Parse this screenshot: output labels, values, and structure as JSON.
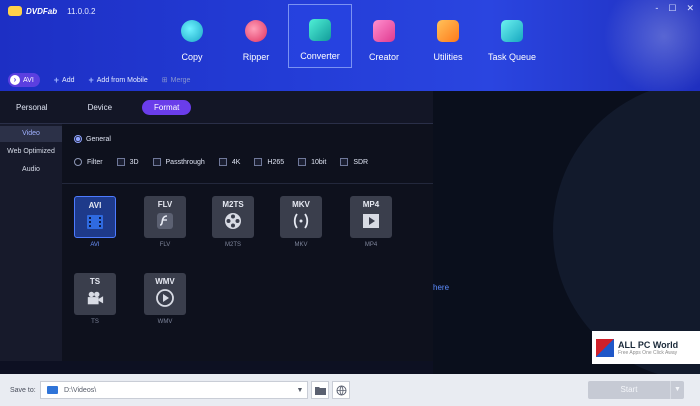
{
  "app": {
    "logo": "DVDFab",
    "version": "11.0.0.2"
  },
  "window_controls": [
    "-",
    "☐",
    "✕"
  ],
  "nav": [
    {
      "label": "Copy",
      "icon": "copy-icon",
      "color": "#29c7d9"
    },
    {
      "label": "Ripper",
      "icon": "ripper-icon",
      "color": "#ff4f7a"
    },
    {
      "label": "Converter",
      "icon": "converter-icon",
      "color": "#28c7b8"
    },
    {
      "label": "Creator",
      "icon": "creator-icon",
      "color": "#ff5aa8"
    },
    {
      "label": "Utilities",
      "icon": "utilities-icon",
      "color": "#ff9b32"
    },
    {
      "label": "Task Queue",
      "icon": "task-queue-icon",
      "color": "#2ad0d6"
    }
  ],
  "toolbar": {
    "format_pill": "AVI",
    "add": "Add",
    "add_mobile": "Add from Mobile",
    "merge": "Merge"
  },
  "panel": {
    "tabs": [
      "Personal",
      "Device",
      "Format"
    ],
    "categories": [
      "Video",
      "Web Optimized",
      "Audio"
    ],
    "general_label": "General",
    "filter_label": "Filter",
    "filters": [
      "3D",
      "Passthrough",
      "4K",
      "H265",
      "10bit",
      "SDR"
    ]
  },
  "formats": [
    {
      "title": "AVI",
      "label": "AVI",
      "icon": "film-icon"
    },
    {
      "title": "FLV",
      "label": "FLV",
      "icon": "flash-icon"
    },
    {
      "title": "M2TS",
      "label": "M2TS",
      "icon": "reel-icon"
    },
    {
      "title": "MKV",
      "label": "MKV",
      "icon": "mkv-icon"
    },
    {
      "title": "MP4",
      "label": "MP4",
      "icon": "play-icon"
    },
    {
      "title": "TS",
      "label": "TS",
      "icon": "camera-icon"
    },
    {
      "title": "WMV",
      "label": "WMV",
      "icon": "play-circle-icon"
    }
  ],
  "right": {
    "link_text": "here"
  },
  "watermark": {
    "title": "ALL PC World",
    "sub": "Free Apps One Click Away"
  },
  "bottom": {
    "save_label": "Save to:",
    "path": "D:\\Videos\\",
    "start": "Start"
  }
}
